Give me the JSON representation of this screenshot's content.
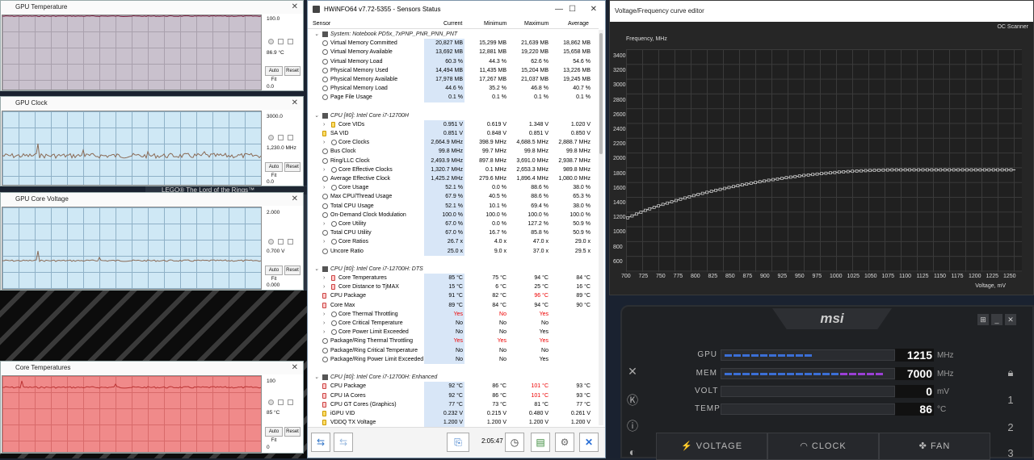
{
  "graphs": [
    {
      "title": "GPU Temperature",
      "top_val": "100.0",
      "cur_val": "86.9 °C",
      "bottom_val": "0.0",
      "auto": "Auto Fit",
      "reset": "Reset"
    },
    {
      "title": "GPU Clock",
      "top_val": "3000.0",
      "cur_val": "1,230.0 MHz",
      "bottom_val": "0.0",
      "auto": "Auto Fit",
      "reset": "Reset"
    },
    {
      "title": "GPU Core Voltage",
      "top_val": "2.000",
      "cur_val": "0.700 V",
      "bottom_val": "0.000",
      "auto": "Auto Fit",
      "reset": "Reset"
    },
    {
      "title": "Core Temperatures",
      "top_val": "100",
      "cur_val": "85 °C",
      "bottom_val": "0",
      "auto": "Auto Fit",
      "reset": "Reset"
    }
  ],
  "desktop": {
    "game_label": "LEGO® The Lord of the Rings™"
  },
  "hwinfo": {
    "title": "HWiNFO64 v7.72-5355 - Sensors Status",
    "columns": {
      "sensor": "Sensor",
      "current": "Current",
      "minimum": "Minimum",
      "maximum": "Maximum",
      "average": "Average"
    },
    "rows": [
      {
        "g": 1,
        "n": "System: Notebook PD5x_7xPNP_PNR_PNN_PNT"
      },
      {
        "n": "Virtual Memory Committed",
        "c": "20,827 MB",
        "mi": "15,299 MB",
        "ma": "21,639 MB",
        "a": "18,862 MB"
      },
      {
        "n": "Virtual Memory Available",
        "c": "13,692 MB",
        "mi": "12,881 MB",
        "ma": "19,220 MB",
        "a": "15,658 MB"
      },
      {
        "n": "Virtual Memory Load",
        "c": "60.3 %",
        "mi": "44.3 %",
        "ma": "62.6 %",
        "a": "54.6 %"
      },
      {
        "n": "Physical Memory Used",
        "c": "14,494 MB",
        "mi": "11,435 MB",
        "ma": "15,204 MB",
        "a": "13,226 MB"
      },
      {
        "n": "Physical Memory Available",
        "c": "17,978 MB",
        "mi": "17,267 MB",
        "ma": "21,037 MB",
        "a": "19,245 MB"
      },
      {
        "n": "Physical Memory Load",
        "c": "44.6 %",
        "mi": "35.2 %",
        "ma": "46.8 %",
        "a": "40.7 %"
      },
      {
        "n": "Page File Usage",
        "c": "0.1 %",
        "mi": "0.1 %",
        "ma": "0.1 %",
        "a": "0.1 %"
      },
      {
        "blank": 1
      },
      {
        "g": 1,
        "n": "CPU [#0]: Intel Core i7-12700H"
      },
      {
        "s": 1,
        "e": 1,
        "i": "y",
        "n": "Core VIDs",
        "c": "0.951 V",
        "mi": "0.619 V",
        "ma": "1.348 V",
        "a": "1.020 V"
      },
      {
        "i": "y",
        "n": "SA VID",
        "c": "0.851 V",
        "mi": "0.848 V",
        "ma": "0.851 V",
        "a": "0.850 V"
      },
      {
        "s": 1,
        "e": 1,
        "n": "Core Clocks",
        "c": "2,664.9 MHz",
        "mi": "398.9 MHz",
        "ma": "4,688.5 MHz",
        "a": "2,888.7 MHz"
      },
      {
        "n": "Bus Clock",
        "c": "99.8 MHz",
        "mi": "99.7 MHz",
        "ma": "99.8 MHz",
        "a": "99.8 MHz"
      },
      {
        "n": "Ring/LLC Clock",
        "c": "2,493.9 MHz",
        "mi": "897.8 MHz",
        "ma": "3,691.0 MHz",
        "a": "2,938.7 MHz"
      },
      {
        "s": 1,
        "e": 1,
        "n": "Core Effective Clocks",
        "c": "1,320.7 MHz",
        "mi": "0.1 MHz",
        "ma": "2,653.3 MHz",
        "a": "989.8 MHz"
      },
      {
        "n": "Average Effective Clock",
        "c": "1,425.2 MHz",
        "mi": "279.6 MHz",
        "ma": "1,896.4 MHz",
        "a": "1,080.0 MHz"
      },
      {
        "s": 1,
        "e": 1,
        "n": "Core Usage",
        "c": "52.1 %",
        "mi": "0.0 %",
        "ma": "88.6 %",
        "a": "38.0 %"
      },
      {
        "n": "Max CPU/Thread Usage",
        "c": "67.9 %",
        "mi": "40.5 %",
        "ma": "88.6 %",
        "a": "65.3 %"
      },
      {
        "n": "Total CPU Usage",
        "c": "52.1 %",
        "mi": "10.1 %",
        "ma": "69.4 %",
        "a": "38.0 %"
      },
      {
        "n": "On-Demand Clock Modulation",
        "c": "100.0 %",
        "mi": "100.0 %",
        "ma": "100.0 %",
        "a": "100.0 %"
      },
      {
        "s": 1,
        "e": 1,
        "n": "Core Utility",
        "c": "67.0 %",
        "mi": "0.0 %",
        "ma": "127.2 %",
        "a": "50.9 %"
      },
      {
        "n": "Total CPU Utility",
        "c": "67.0 %",
        "mi": "16.7 %",
        "ma": "85.8 %",
        "a": "50.9 %"
      },
      {
        "s": 1,
        "e": 1,
        "n": "Core Ratios",
        "c": "26.7 x",
        "mi": "4.0 x",
        "ma": "47.0 x",
        "a": "29.0 x"
      },
      {
        "n": "Uncore Ratio",
        "c": "25.0 x",
        "mi": "9.0 x",
        "ma": "37.0 x",
        "a": "29.5 x"
      },
      {
        "blank": 1
      },
      {
        "g": 1,
        "n": "CPU [#0]: Intel Core i7-12700H: DTS"
      },
      {
        "s": 1,
        "e": 1,
        "i": "t",
        "n": "Core Temperatures",
        "c": "85 °C",
        "mi": "75 °C",
        "ma": "94 °C",
        "a": "84 °C"
      },
      {
        "s": 1,
        "e": 1,
        "i": "t",
        "n": "Core Distance to TjMAX",
        "c": "15 °C",
        "mi": "6 °C",
        "ma": "25 °C",
        "a": "16 °C"
      },
      {
        "i": "t",
        "n": "CPU Package",
        "c": "91 °C",
        "mi": "82 °C",
        "ma": "96 °C",
        "a": "89 °C",
        "maxred": 1
      },
      {
        "i": "t",
        "n": "Core Max",
        "c": "89 °C",
        "mi": "84 °C",
        "ma": "94 °C",
        "a": "90 °C"
      },
      {
        "s": 1,
        "e": 1,
        "n": "Core Thermal Throttling",
        "c": "Yes",
        "mi": "No",
        "ma": "Yes",
        "a": "",
        "red": 1
      },
      {
        "s": 1,
        "e": 1,
        "n": "Core Critical Temperature",
        "c": "No",
        "mi": "No",
        "ma": "No",
        "a": ""
      },
      {
        "s": 1,
        "e": 1,
        "n": "Core Power Limit Exceeded",
        "c": "No",
        "mi": "No",
        "ma": "Yes",
        "a": ""
      },
      {
        "n": "Package/Ring Thermal Throttling",
        "c": "Yes",
        "mi": "Yes",
        "ma": "Yes",
        "a": "",
        "red": 1
      },
      {
        "n": "Package/Ring Critical Temperature",
        "c": "No",
        "mi": "No",
        "ma": "No",
        "a": ""
      },
      {
        "n": "Package/Ring Power Limit Exceeded",
        "c": "No",
        "mi": "No",
        "ma": "Yes",
        "a": ""
      },
      {
        "blank": 1
      },
      {
        "g": 1,
        "n": "CPU [#0]: Intel Core i7-12700H: Enhanced"
      },
      {
        "i": "t",
        "n": "CPU Package",
        "c": "92 °C",
        "mi": "86 °C",
        "ma": "101 °C",
        "a": "93 °C",
        "maxred": 1
      },
      {
        "i": "t",
        "n": "CPU IA Cores",
        "c": "92 °C",
        "mi": "86 °C",
        "ma": "101 °C",
        "a": "93 °C",
        "maxred": 1
      },
      {
        "i": "t",
        "n": "CPU GT Cores (Graphics)",
        "c": "77 °C",
        "mi": "73 °C",
        "ma": "81 °C",
        "a": "77 °C"
      },
      {
        "i": "y",
        "n": "iGPU VID",
        "c": "0.232 V",
        "mi": "0.215 V",
        "ma": "0.480 V",
        "a": "0.261 V"
      },
      {
        "i": "y",
        "n": "VDDQ TX Voltage",
        "c": "1.200 V",
        "mi": "1.200 V",
        "ma": "1.200 V",
        "a": "1.200 V"
      }
    ],
    "time": "2:05:47"
  },
  "vf": {
    "title": "Voltage/Frequency curve editor",
    "oc_scanner": "OC Scanner",
    "ylabel": "Frequency, MHz",
    "xlabel": "Voltage, mV",
    "yticks": [
      "3400",
      "3200",
      "3000",
      "2800",
      "2600",
      "2400",
      "2200",
      "2000",
      "1800",
      "1600",
      "1400",
      "1200",
      "1000",
      "800",
      "600"
    ],
    "xticks": [
      "700",
      "725",
      "750",
      "775",
      "800",
      "825",
      "850",
      "875",
      "900",
      "925",
      "950",
      "975",
      "1000",
      "1025",
      "1050",
      "1075",
      "1100",
      "1125",
      "1150",
      "1175",
      "1200",
      "1225",
      "1250"
    ]
  },
  "chart_data": {
    "type": "line",
    "xlabel": "Voltage, mV",
    "ylabel": "Frequency, MHz",
    "xlim": [
      700,
      1250
    ],
    "ylim": [
      500,
      3500
    ],
    "x": [
      700,
      725,
      750,
      775,
      800,
      825,
      850,
      875,
      900,
      925,
      950,
      975,
      1000,
      1025,
      1050,
      1075,
      1100,
      1125,
      1150,
      1175,
      1200,
      1225,
      1250
    ],
    "series": [
      {
        "values": [
          1230,
          1330,
          1410,
          1480,
          1545,
          1600,
          1650,
          1695,
          1735,
          1770,
          1800,
          1825,
          1845,
          1860,
          1870,
          1875,
          1875,
          1875,
          1875,
          1875,
          1875,
          1875,
          1875
        ]
      }
    ]
  },
  "msi": {
    "logo": "msi",
    "gpu": {
      "label": "GPU",
      "value": "1215",
      "unit": "MHz"
    },
    "mem": {
      "label": "MEM",
      "value": "7000",
      "unit": "MHz"
    },
    "volt": {
      "label": "VOLT",
      "value": "0",
      "unit": "mV"
    },
    "temp": {
      "label": "TEMP",
      "value": "86",
      "unit": "°C"
    },
    "tabs": {
      "voltage": "VOLTAGE",
      "clock": "CLOCK",
      "fan": "FAN"
    },
    "profiles": [
      "1",
      "2",
      "3"
    ],
    "accent_colors": {
      "blue": "#3b6fd6",
      "purple": "#9b3fd6",
      "bar_bg": "#2a2c30"
    }
  }
}
